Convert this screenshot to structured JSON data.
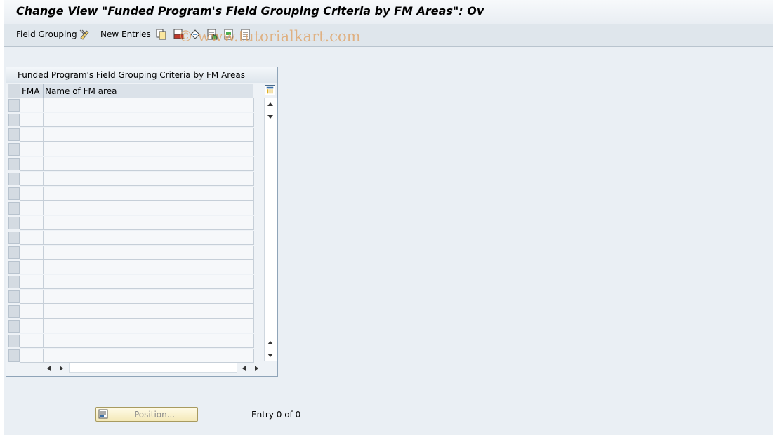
{
  "window": {
    "title": "Change View \"Funded Program's Field Grouping Criteria by FM Areas\": Ov"
  },
  "toolbar": {
    "field_grouping_label": "Field Grouping",
    "new_entries_label": "New Entries",
    "watermark": "© www.tutorialkart.com"
  },
  "table": {
    "title": "Funded Program's Field Grouping Criteria by FM Areas",
    "columns": [
      "FMA",
      "Name of FM area"
    ],
    "row_count": 18
  },
  "footer": {
    "position_label": "Position...",
    "entry_info": "Entry 0 of 0"
  },
  "colors": {
    "background": "#eaeff4",
    "toolbar": "#dfe6ec",
    "button_face": "#f4e9b8"
  }
}
